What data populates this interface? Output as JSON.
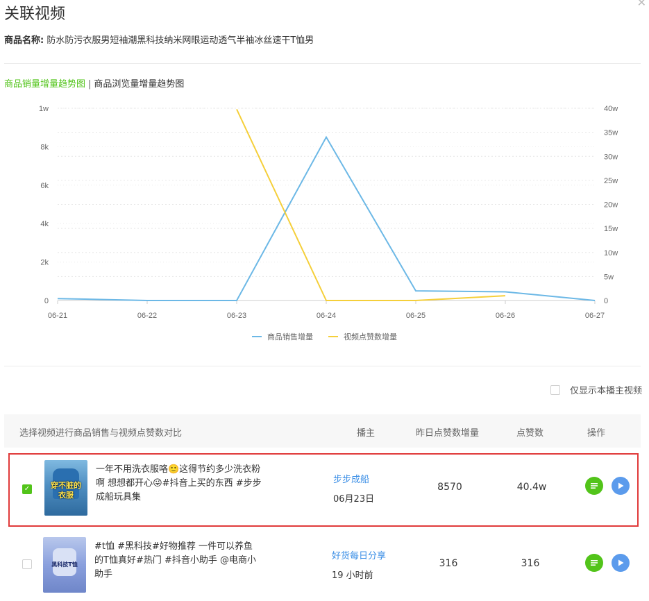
{
  "dialog": {
    "title": "关联视频"
  },
  "product": {
    "label": "商品名称:",
    "name": "防水防污衣服男短袖潮黑科技纳米网眼运动透气半袖冰丝速干T恤男"
  },
  "tabs": {
    "sales": "商品销量增量趋势图",
    "separator": "|",
    "views": "商品浏览量增量趋势图"
  },
  "chart_data": {
    "type": "line",
    "categories": [
      "06-21",
      "06-22",
      "06-23",
      "06-24",
      "06-25",
      "06-26",
      "06-27"
    ],
    "left_axis": {
      "ticks": [
        "0",
        "2k",
        "4k",
        "6k",
        "8k",
        "1w"
      ],
      "ylim": [
        0,
        10000
      ]
    },
    "right_axis": {
      "ticks": [
        "0",
        "5w",
        "10w",
        "15w",
        "20w",
        "25w",
        "30w",
        "35w",
        "40w"
      ],
      "ylim": [
        0,
        400000
      ]
    },
    "series": [
      {
        "name": "商品销售增量",
        "axis": "left",
        "color": "#6cb8e6",
        "values": [
          100,
          0,
          0,
          8500,
          500,
          450,
          0
        ]
      },
      {
        "name": "视频点赞数增量",
        "axis": "right",
        "color": "#f5cf3a",
        "values": [
          null,
          null,
          398000,
          0,
          0,
          10000,
          null
        ]
      }
    ],
    "legend": "bottom-center",
    "grid": true
  },
  "filter": {
    "only_anchor_label": "仅显示本播主视频"
  },
  "table": {
    "headers": {
      "select": "选择视频进行商品销售与视频点赞数对比",
      "anchor": "播主",
      "likes_increase": "昨日点赞数增量",
      "likes": "点赞数",
      "actions": "操作"
    },
    "rows": [
      {
        "checked": true,
        "thumb_text": "穿不脏的衣服",
        "desc": "一年不用洗衣服咯🙂这得节约多少洗衣粉啊 想想都开心😜#抖音上买的东西 #步步成船玩具集",
        "anchor": "步步成船",
        "time": "06月23日",
        "likes_increase": "8570",
        "likes": "40.4w"
      },
      {
        "checked": false,
        "thumb_text": "黑科技T恤",
        "desc": "#t恤 #黑科技#好物推荐 一件可以养鱼的T恤真好#热门 #抖音小助手 @电商小助手",
        "anchor": "好货每日分享",
        "time": "19 小时前",
        "likes_increase": "316",
        "likes": "316"
      }
    ]
  }
}
